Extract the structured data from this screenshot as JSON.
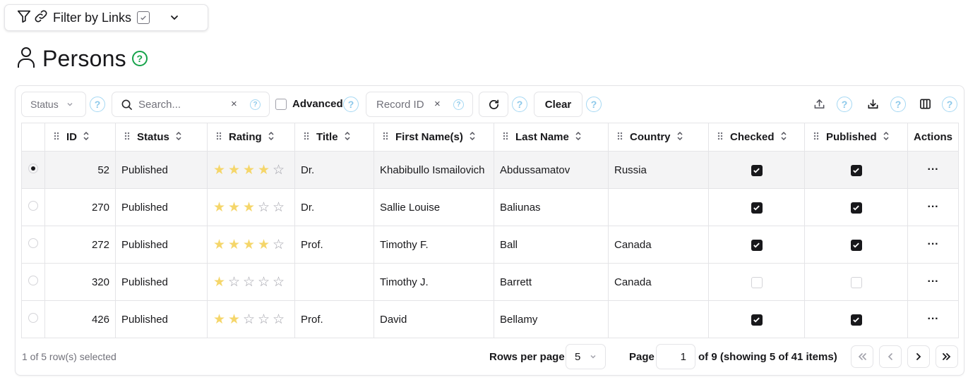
{
  "filter": {
    "label": "Filter by Links"
  },
  "page": {
    "title": "Persons",
    "help": "?"
  },
  "toolbar": {
    "status_placeholder": "Status",
    "search_placeholder": "Search...",
    "search_clear": "×",
    "advanced_label": "Advanced",
    "record_id_placeholder": "Record ID",
    "record_clear": "×",
    "clear_label": "Clear",
    "help": "?"
  },
  "table": {
    "headers": [
      "ID",
      "Status",
      "Rating",
      "Title",
      "First Name(s)",
      "Last Name",
      "Country",
      "Checked",
      "Published",
      "Actions"
    ],
    "rows": [
      {
        "selected": true,
        "id": "52",
        "status": "Published",
        "rating": 4,
        "title": "Dr.",
        "first": "Khabibullo Ismailovich",
        "last": "Abdussamatov",
        "country": "Russia",
        "checked": true,
        "published": true
      },
      {
        "selected": false,
        "id": "270",
        "status": "Published",
        "rating": 3,
        "title": "Dr.",
        "first": "Sallie Louise",
        "last": "Baliunas",
        "country": "",
        "checked": true,
        "published": true
      },
      {
        "selected": false,
        "id": "272",
        "status": "Published",
        "rating": 4,
        "title": "Prof.",
        "first": "Timothy F.",
        "last": "Ball",
        "country": "Canada",
        "checked": true,
        "published": true
      },
      {
        "selected": false,
        "id": "320",
        "status": "Published",
        "rating": 1,
        "title": "",
        "first": "Timothy J.",
        "last": "Barrett",
        "country": "Canada",
        "checked": false,
        "published": false
      },
      {
        "selected": false,
        "id": "426",
        "status": "Published",
        "rating": 2,
        "title": "Prof.",
        "first": "David",
        "last": "Bellamy",
        "country": "",
        "checked": true,
        "published": true
      }
    ],
    "actions_label": "···",
    "max_rating": 5
  },
  "footer": {
    "selection": "1 of 5 row(s) selected",
    "rows_per_page_label": "Rows per page",
    "rows_per_page": "5",
    "page_label": "Page",
    "page_value": "1",
    "page_info": "of 9 (showing 5 of 41 items)"
  }
}
